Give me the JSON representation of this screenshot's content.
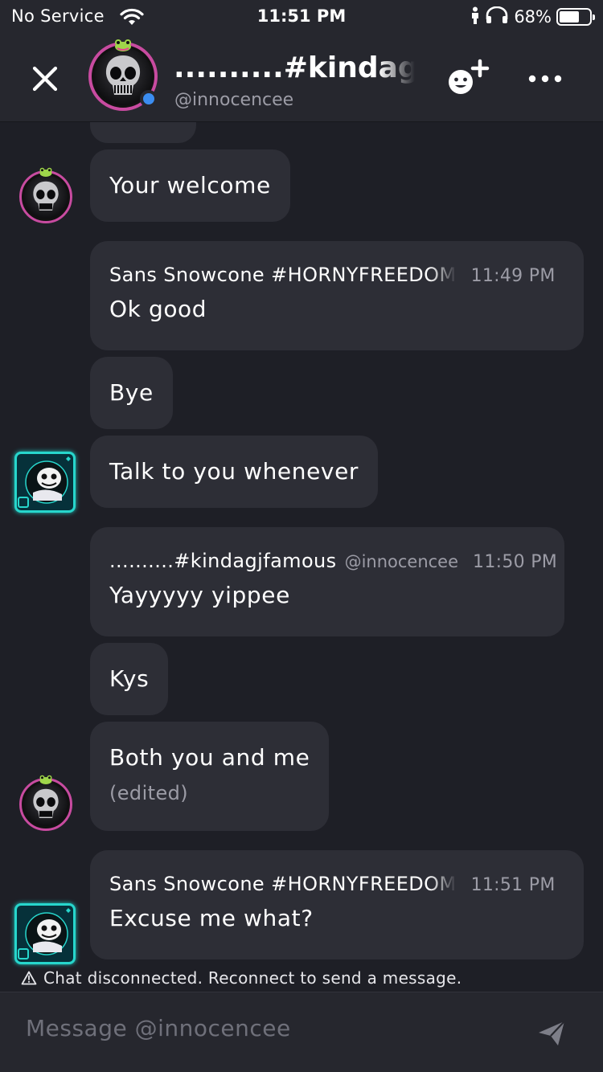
{
  "status_bar": {
    "carrier": "No Service",
    "time": "11:51 PM",
    "battery_percent": "68%",
    "battery_level": 0.68,
    "icons": [
      "wifi-icon",
      "person-icon",
      "headphones-icon",
      "battery-icon"
    ]
  },
  "header": {
    "title": "..........#kindagjfamous",
    "subtitle": "@innocencee",
    "icons": [
      "close-icon",
      "add-friend-icon",
      "more-icon"
    ]
  },
  "messages": [
    {
      "text": "Your welcome"
    },
    {
      "author": "Sans Snowcone #HORNYFREEDOM",
      "time": "11:49 PM",
      "text": "Ok good"
    },
    {
      "text": "Bye"
    },
    {
      "text": "Talk to you whenever"
    },
    {
      "author": "..........#kindagjfamous",
      "handle": "@innocencee",
      "time": "11:50 PM",
      "text": "Yayyyyy yippee"
    },
    {
      "text": "Kys"
    },
    {
      "text": "Both you and me",
      "edited": "(edited)"
    },
    {
      "author": "Sans Snowcone #HORNYFREEDOM",
      "time": "11:51 PM",
      "text": "Excuse me what?"
    }
  ],
  "notice": {
    "icon": "warning-icon",
    "text": "Chat disconnected. Reconnect to send a message."
  },
  "composer": {
    "placeholder": "Message @innocencee",
    "send_icon": "send-icon"
  },
  "colors": {
    "background": "#1e1f26",
    "bubble": "#2d2e36",
    "online": "#3b8df1",
    "avatar_ring_pink": "#c84ba0",
    "avatar_frame_teal": "#27d6cc"
  }
}
